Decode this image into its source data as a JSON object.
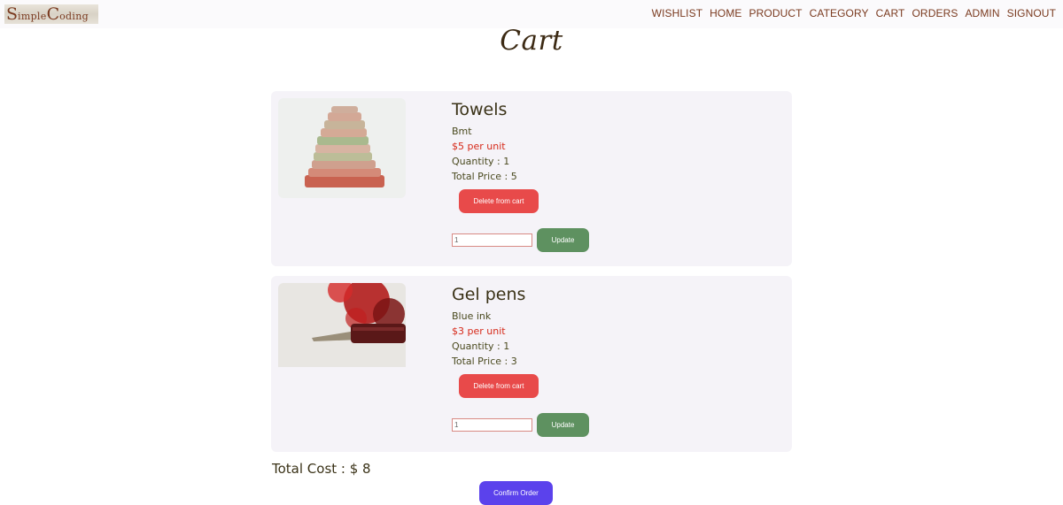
{
  "logo": {
    "first_initial": "S",
    "first_rest": "imple",
    "second_initial": "C",
    "second_rest": "oding"
  },
  "nav": {
    "items": [
      "WISHLIST",
      "HOME",
      "PRODUCT",
      "CATEGORY",
      "CART",
      "ORDERS",
      "ADMIN",
      "SIGNOUT"
    ]
  },
  "page": {
    "title": "Cart"
  },
  "cart": {
    "items": [
      {
        "name": "Towels",
        "description": "Bmt",
        "price": "$5 per unit",
        "quantity": "Quantity : 1",
        "total": "Total Price : 5",
        "delete_label": "Delete from cart",
        "qty_value": "1",
        "update_label": "Update",
        "image_icon": "towels-photo"
      },
      {
        "name": "Gel pens",
        "description": "Blue ink",
        "price": "$3 per unit",
        "quantity": "Quantity : 1",
        "total": "Total Price : 3",
        "delete_label": "Delete from cart",
        "qty_value": "1",
        "update_label": "Update",
        "image_icon": "pen-photo"
      }
    ],
    "total_cost": "Total Cost : $ 8",
    "confirm_label": "Confirm Order"
  },
  "colors": {
    "nav_text": "#7a3a1f",
    "price_text": "#d62a1a",
    "delete_button": "#e84a4a",
    "update_button": "#5e9160",
    "confirm_button": "#5b42ec",
    "card_background": "#f5f3f8"
  }
}
